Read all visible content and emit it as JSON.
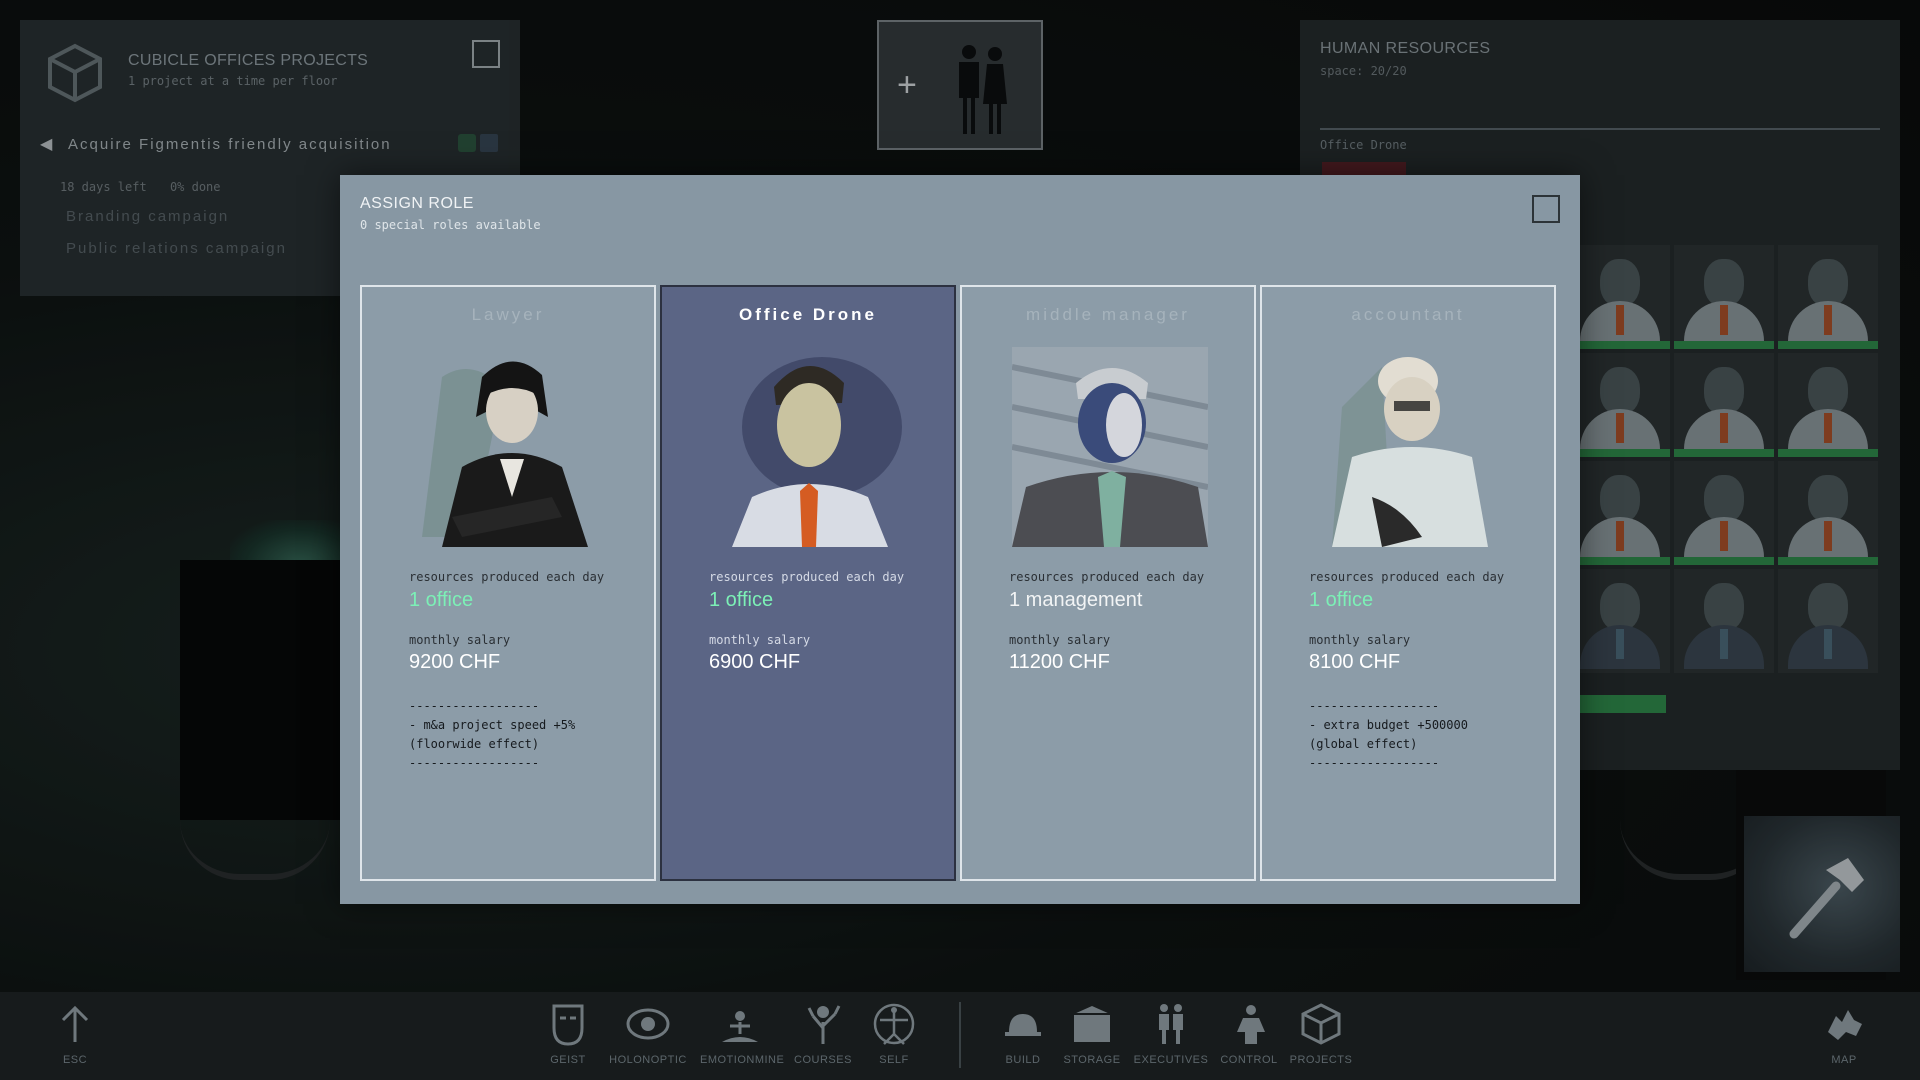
{
  "projects_panel": {
    "title": "CUBICLE OFFICES PROJECTS",
    "subtitle": "1 project at a time per floor",
    "active_project": "Acquire Figmentis friendly acquisition",
    "days_left": "18 days left",
    "done": "0% done",
    "items": [
      "Branding campaign",
      "Public relations campaign"
    ]
  },
  "hr_panel": {
    "title": "HUMAN RESOURCES",
    "space": "space: 20/20",
    "role_label": "Office Drone"
  },
  "modal": {
    "title": "ASSIGN ROLE",
    "subtitle": "0 special roles available",
    "cards": [
      {
        "title": "Lawyer",
        "res_label": "resources produced each day",
        "res_value": "1 office",
        "salary_label": "monthly salary",
        "salary_value": "9200 CHF",
        "separator": "------------------",
        "effect_line1": "- m&a project speed +5%",
        "effect_line2": "(floorwide effect)"
      },
      {
        "title": "Office Drone",
        "res_label": "resources produced each day",
        "res_value": "1 office",
        "salary_label": "monthly salary",
        "salary_value": "6900 CHF"
      },
      {
        "title": "middle manager",
        "res_label": "resources produced each day",
        "res_value": "1 management",
        "salary_label": "monthly salary",
        "salary_value": "11200 CHF"
      },
      {
        "title": "accountant",
        "res_label": "resources produced each day",
        "res_value": "1 office",
        "salary_label": "monthly salary",
        "salary_value": "8100 CHF",
        "separator": "------------------",
        "effect_line1": "- extra budget +500000",
        "effect_line2": "(global effect)"
      }
    ],
    "selected_card": "Office Drone"
  },
  "toolbar": {
    "esc": "ESC",
    "geist": "GEIST",
    "holonoptic": "HOLONOPTIC",
    "emotionmine": "EMOTIONMINE",
    "courses": "COURSES",
    "self": "SELF",
    "build": "BUILD",
    "storage": "STORAGE",
    "executives": "EXECUTIVES",
    "control": "CONTROL",
    "projects": "PROJECTS",
    "map": "MAP"
  },
  "colors": {
    "modal_bg": "#8797a3",
    "selected_card": "#5b6585",
    "resource_green": "#7cf0b6",
    "progress_green": "#2f8a4b"
  }
}
